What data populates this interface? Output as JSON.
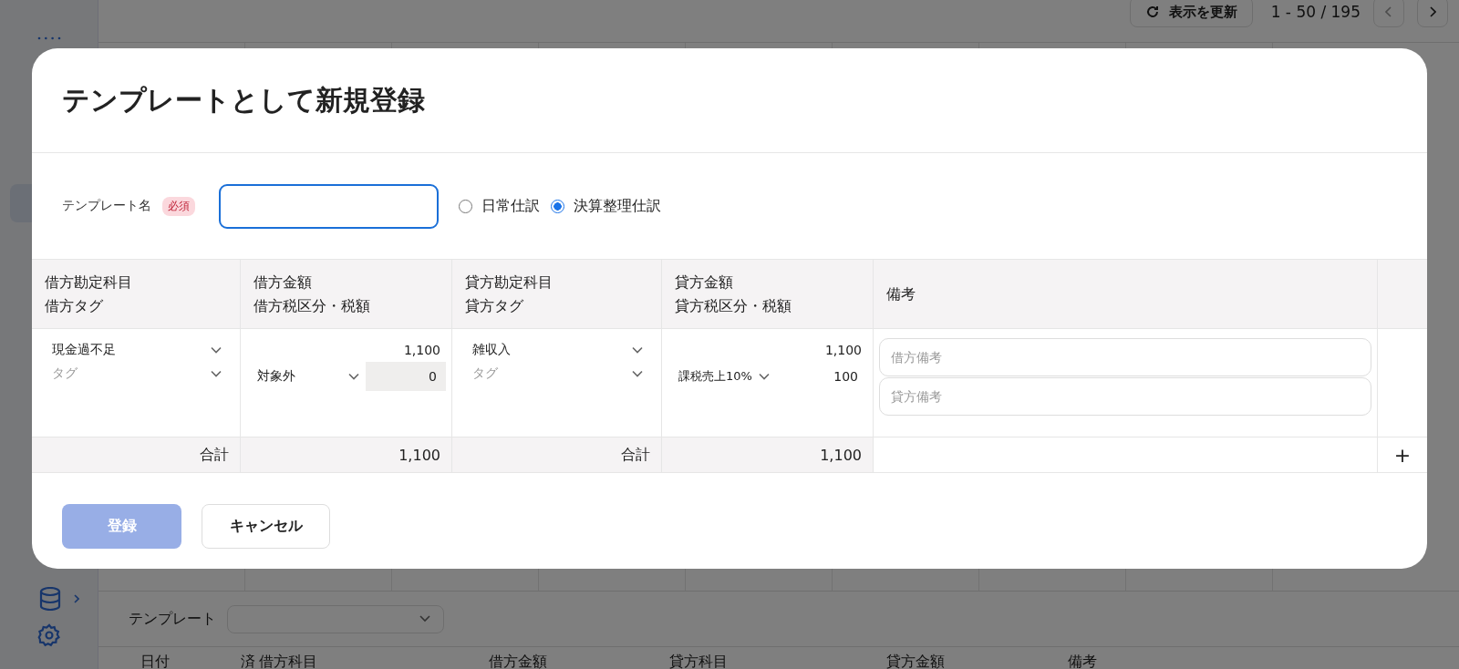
{
  "toolbar": {
    "refresh_button": "表示を更新",
    "pagination": "1 - 50 / 195"
  },
  "template_bar": {
    "label": "テンプレート"
  },
  "list_columns": [
    "日付",
    "済",
    "借方科目",
    "借方金額",
    "貸方科目",
    "貸方金額",
    "備考"
  ],
  "dialog": {
    "title": "テンプレートとして新規登録",
    "name_label": "テンプレート名",
    "required_badge": "必須",
    "journal_types": [
      {
        "label": "日常仕訳",
        "selected": false
      },
      {
        "label": "決算整理仕訳",
        "selected": true
      }
    ],
    "columns": [
      {
        "lines": [
          "借方勘定科目",
          "借方タグ"
        ]
      },
      {
        "lines": [
          "借方金額",
          "借方税区分・税額"
        ]
      },
      {
        "lines": [
          "貸方勘定科目",
          "貸方タグ"
        ]
      },
      {
        "lines": [
          "貸方金額",
          "貸方税区分・税額"
        ]
      },
      {
        "lines": [
          "備考"
        ]
      }
    ],
    "rows": [
      {
        "debit_account": "現金過不足",
        "debit_tag": {
          "placeholder": "タグ"
        },
        "debit_amount": "1,100",
        "debit_tax": "対象外",
        "debit_tax_amount": {
          "value": "0",
          "disabled": true
        },
        "credit_account": "雑収入",
        "credit_tag": {
          "placeholder": "タグ"
        },
        "credit_amount": "1,100",
        "credit_tax": "課税売上10%",
        "credit_tax_amount": {
          "value": "100",
          "disabled": false
        },
        "debit_memo": {
          "placeholder": "借方備考"
        },
        "credit_memo": {
          "placeholder": "貸方備考"
        }
      }
    ],
    "totals": {
      "debit_label": "合計",
      "debit_amount": "1,100",
      "credit_label": "合計",
      "credit_amount": "1,100"
    },
    "add_row": "+",
    "buttons": [
      {
        "label": "登録",
        "kind": "primary",
        "disabled": true
      },
      {
        "label": "キャンセル",
        "kind": "secondary",
        "disabled": false
      }
    ]
  }
}
